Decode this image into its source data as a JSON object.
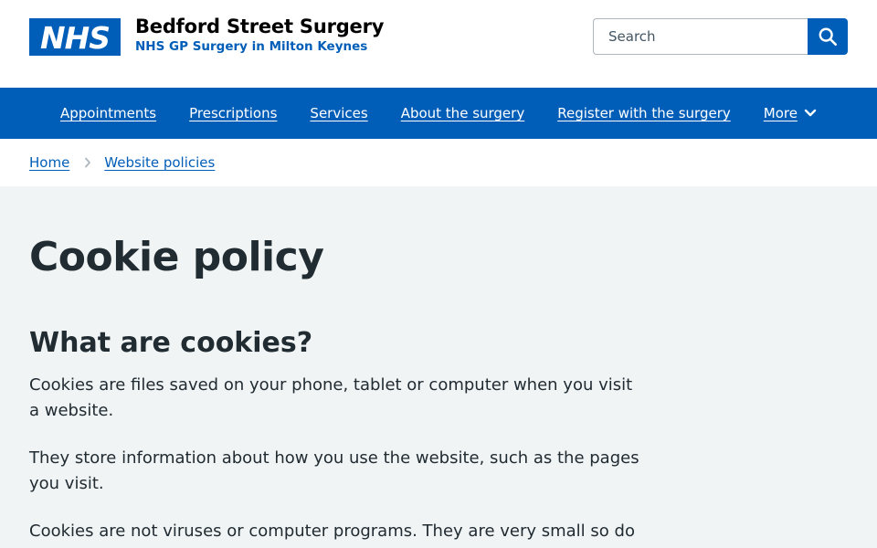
{
  "header": {
    "logo_text": "NHS",
    "org_name": "Bedford Street Surgery",
    "org_subtitle": "NHS GP Surgery in Milton Keynes",
    "search_placeholder": "Search",
    "search_icon": "search-icon",
    "brand_color": "#005eb8"
  },
  "nav": {
    "items": [
      {
        "label": "Appointments"
      },
      {
        "label": "Prescriptions"
      },
      {
        "label": "Services"
      },
      {
        "label": "About the surgery"
      },
      {
        "label": "Register with the surgery"
      },
      {
        "label": "More"
      }
    ],
    "more_icon": "chevron-down-icon"
  },
  "breadcrumb": {
    "items": [
      {
        "label": "Home"
      },
      {
        "label": "Website policies"
      }
    ],
    "separator_icon": "chevron-right-icon"
  },
  "main": {
    "title": "Cookie policy",
    "section_title": "What are cookies?",
    "paragraphs": [
      "Cookies are files saved on your phone, tablet or computer when you visit a website.",
      "They store information about how you use the website, such as the pages you visit.",
      "Cookies are not viruses or computer programs. They are very small so do"
    ]
  }
}
